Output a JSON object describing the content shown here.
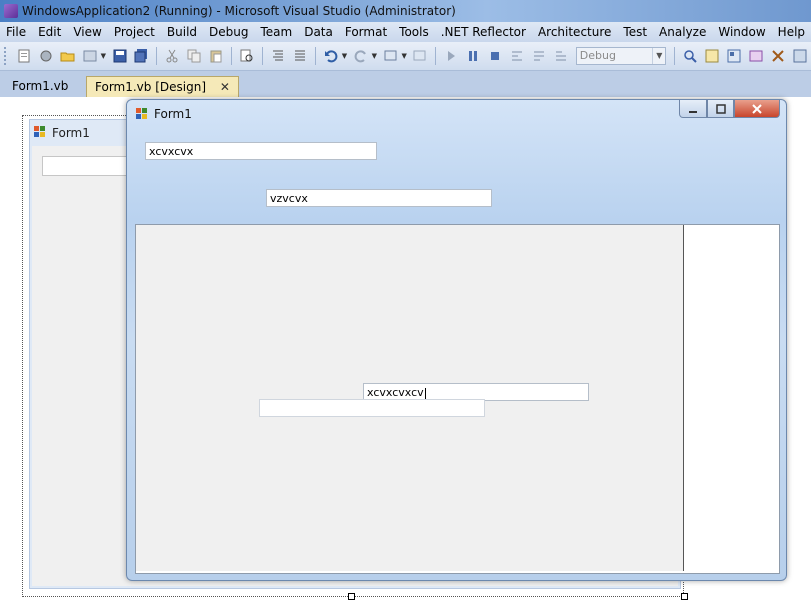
{
  "vs": {
    "title": "WindowsApplication2 (Running) - Microsoft Visual Studio (Administrator)"
  },
  "menu": [
    "File",
    "Edit",
    "View",
    "Project",
    "Build",
    "Debug",
    "Team",
    "Data",
    "Format",
    "Tools",
    ".NET Reflector",
    "Architecture",
    "Test",
    "Analyze",
    "Window",
    "Help"
  ],
  "toolbar": {
    "config_value": "Debug"
  },
  "tabs": {
    "tab1": "Form1.vb",
    "tab2": "Form1.vb [Design]",
    "close_glyph": "✕"
  },
  "designer": {
    "form_title": "Form1"
  },
  "running_form": {
    "title": "Form1",
    "textbox1": "xcvxcvx",
    "textbox2": "vzvcvx",
    "textbox3": "xcvxcvxcv",
    "textbox4": ""
  },
  "colors": {
    "accent": "#4a7fc5",
    "close_red": "#c8452c"
  }
}
